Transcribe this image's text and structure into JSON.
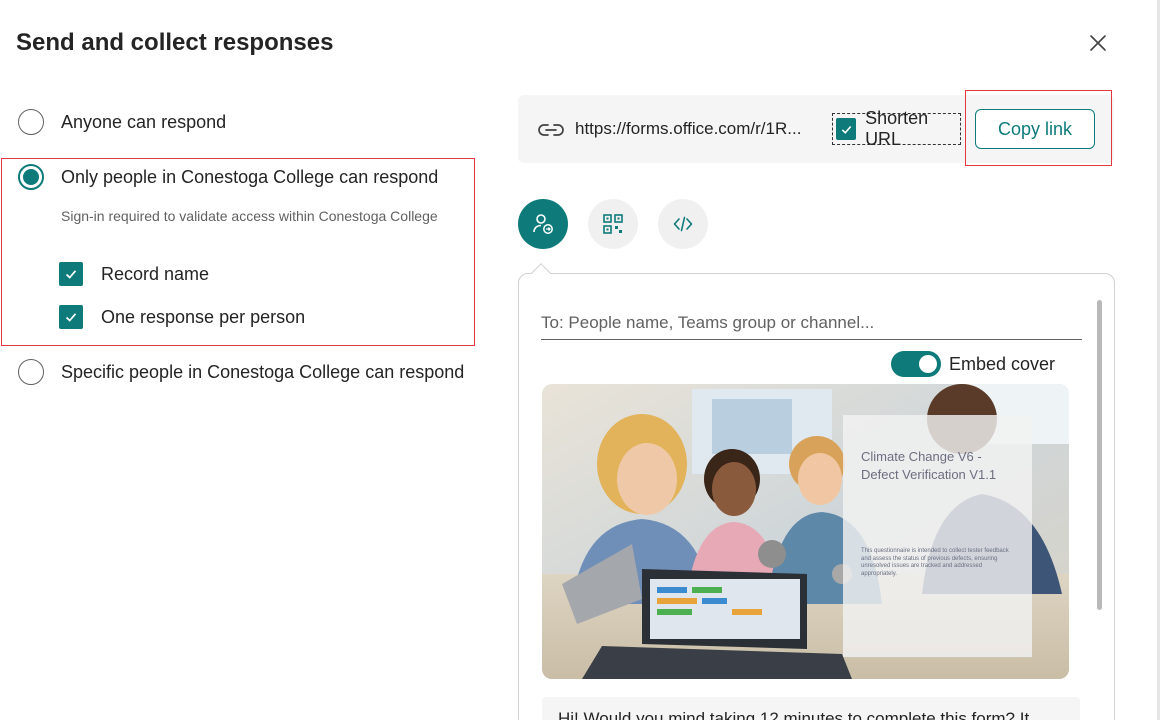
{
  "dialog": {
    "title": "Send and collect responses",
    "close_icon": "close-icon"
  },
  "respond_options": [
    {
      "label": "Anyone can respond",
      "selected": false
    },
    {
      "label": "Only people in Conestoga College can respond",
      "selected": true
    },
    {
      "label": "Specific people in Conestoga College can respond",
      "selected": false
    }
  ],
  "selected_option": {
    "hint": "Sign-in required to validate access within Conestoga College",
    "checkboxes": [
      {
        "label": "Record name",
        "checked": true
      },
      {
        "label": "One response per person",
        "checked": true
      }
    ]
  },
  "link": {
    "icon": "link-icon",
    "url": "https://forms.office.com/r/1R...",
    "shorten_label": "Shorten URL",
    "shorten_checked": true,
    "copy_label": "Copy link"
  },
  "share_methods": [
    {
      "icon": "send-to-person-icon",
      "active": true
    },
    {
      "icon": "qr-code-icon",
      "active": false
    },
    {
      "icon": "embed-code-icon",
      "active": false
    }
  ],
  "share_panel": {
    "to_placeholder": "To: People name, Teams group or channel...",
    "embed_cover_label": "Embed cover",
    "embed_cover_on": true,
    "cover": {
      "title": "Climate Change V6 - Defect Verification V1.1",
      "description": "This questionnaire is intended to collect tester feedback and assess the status of previous defects, ensuring unresolved issues are tracked and addressed appropriately."
    },
    "message": "Hi! Would you mind taking 12 minutes to complete this form? It"
  },
  "colors": {
    "accent": "#0e7a7a",
    "highlight": "#e0393e"
  }
}
